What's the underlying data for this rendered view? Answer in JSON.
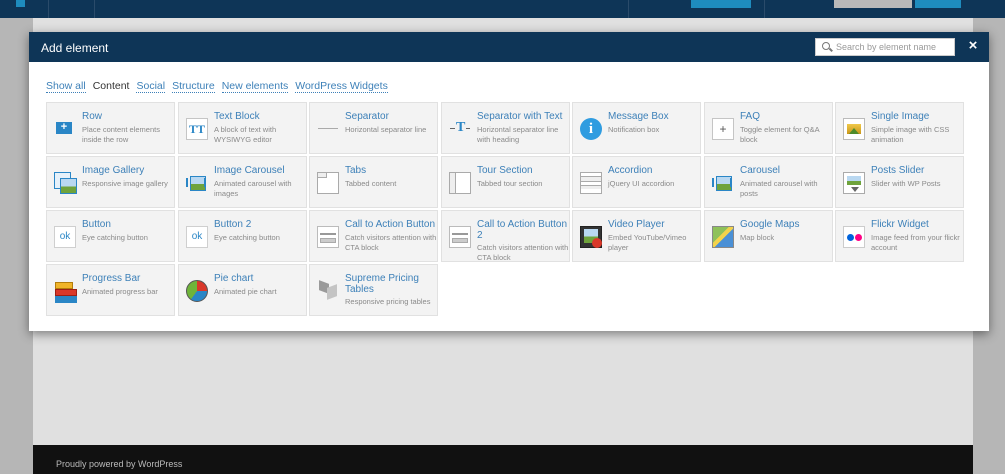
{
  "modal": {
    "title": "Add element",
    "search_placeholder": "Search by element name",
    "close_label": "×"
  },
  "filters": [
    {
      "label": "Show all",
      "active": false
    },
    {
      "label": "Content",
      "active": true
    },
    {
      "label": "Social",
      "active": false
    },
    {
      "label": "Structure",
      "active": false
    },
    {
      "label": "New elements",
      "active": false
    },
    {
      "label": "WordPress Widgets",
      "active": false
    }
  ],
  "elements": [
    {
      "name": "Row",
      "desc": "Place content elements inside the row",
      "icon": "row"
    },
    {
      "name": "Text Block",
      "desc": "A block of text with WYSIWYG editor",
      "icon": "text-block"
    },
    {
      "name": "Separator",
      "desc": "Horizontal separator line",
      "icon": "separator"
    },
    {
      "name": "Separator with Text",
      "desc": "Horizontal separator line with heading",
      "icon": "separator-text"
    },
    {
      "name": "Message Box",
      "desc": "Notification box",
      "icon": "info"
    },
    {
      "name": "FAQ",
      "desc": "Toggle element for Q&A block",
      "icon": "faq"
    },
    {
      "name": "Single Image",
      "desc": "Simple image with CSS animation",
      "icon": "image"
    },
    {
      "name": "Image Gallery",
      "desc": "Responsive image gallery",
      "icon": "gallery"
    },
    {
      "name": "Image Carousel",
      "desc": "Animated carousel with images",
      "icon": "image-carousel"
    },
    {
      "name": "Tabs",
      "desc": "Tabbed content",
      "icon": "tabs"
    },
    {
      "name": "Tour Section",
      "desc": "Tabbed tour section",
      "icon": "tour"
    },
    {
      "name": "Accordion",
      "desc": "jQuery UI accordion",
      "icon": "accordion"
    },
    {
      "name": "Carousel",
      "desc": "Animated carousel with posts",
      "icon": "carousel"
    },
    {
      "name": "Posts Slider",
      "desc": "Slider with WP Posts",
      "icon": "posts-slider"
    },
    {
      "name": "Button",
      "desc": "Eye catching button",
      "icon": "button"
    },
    {
      "name": "Button 2",
      "desc": "Eye catching button",
      "icon": "button"
    },
    {
      "name": "Call to Action Button",
      "desc": "Catch visitors attention with CTA block",
      "icon": "cta"
    },
    {
      "name": "Call to Action Button 2",
      "desc": "Catch visitors attention with CTA block",
      "icon": "cta"
    },
    {
      "name": "Video Player",
      "desc": "Embed YouTube/Vimeo player",
      "icon": "video"
    },
    {
      "name": "Google Maps",
      "desc": "Map block",
      "icon": "map"
    },
    {
      "name": "Flickr Widget",
      "desc": "Image feed from your flickr account",
      "icon": "flickr"
    },
    {
      "name": "Progress Bar",
      "desc": "Animated progress bar",
      "icon": "progress"
    },
    {
      "name": "Pie chart",
      "desc": "Animated pie chart",
      "icon": "pie"
    },
    {
      "name": "Supreme Pricing Tables",
      "desc": "Responsive pricing tables",
      "icon": "pricing"
    }
  ],
  "button_glyph": "ok",
  "footer": {
    "text": "Proudly powered by WordPress"
  },
  "colors": {
    "header": "#0e3557",
    "accent": "#1e8cbe",
    "link": "#3d80b8"
  }
}
